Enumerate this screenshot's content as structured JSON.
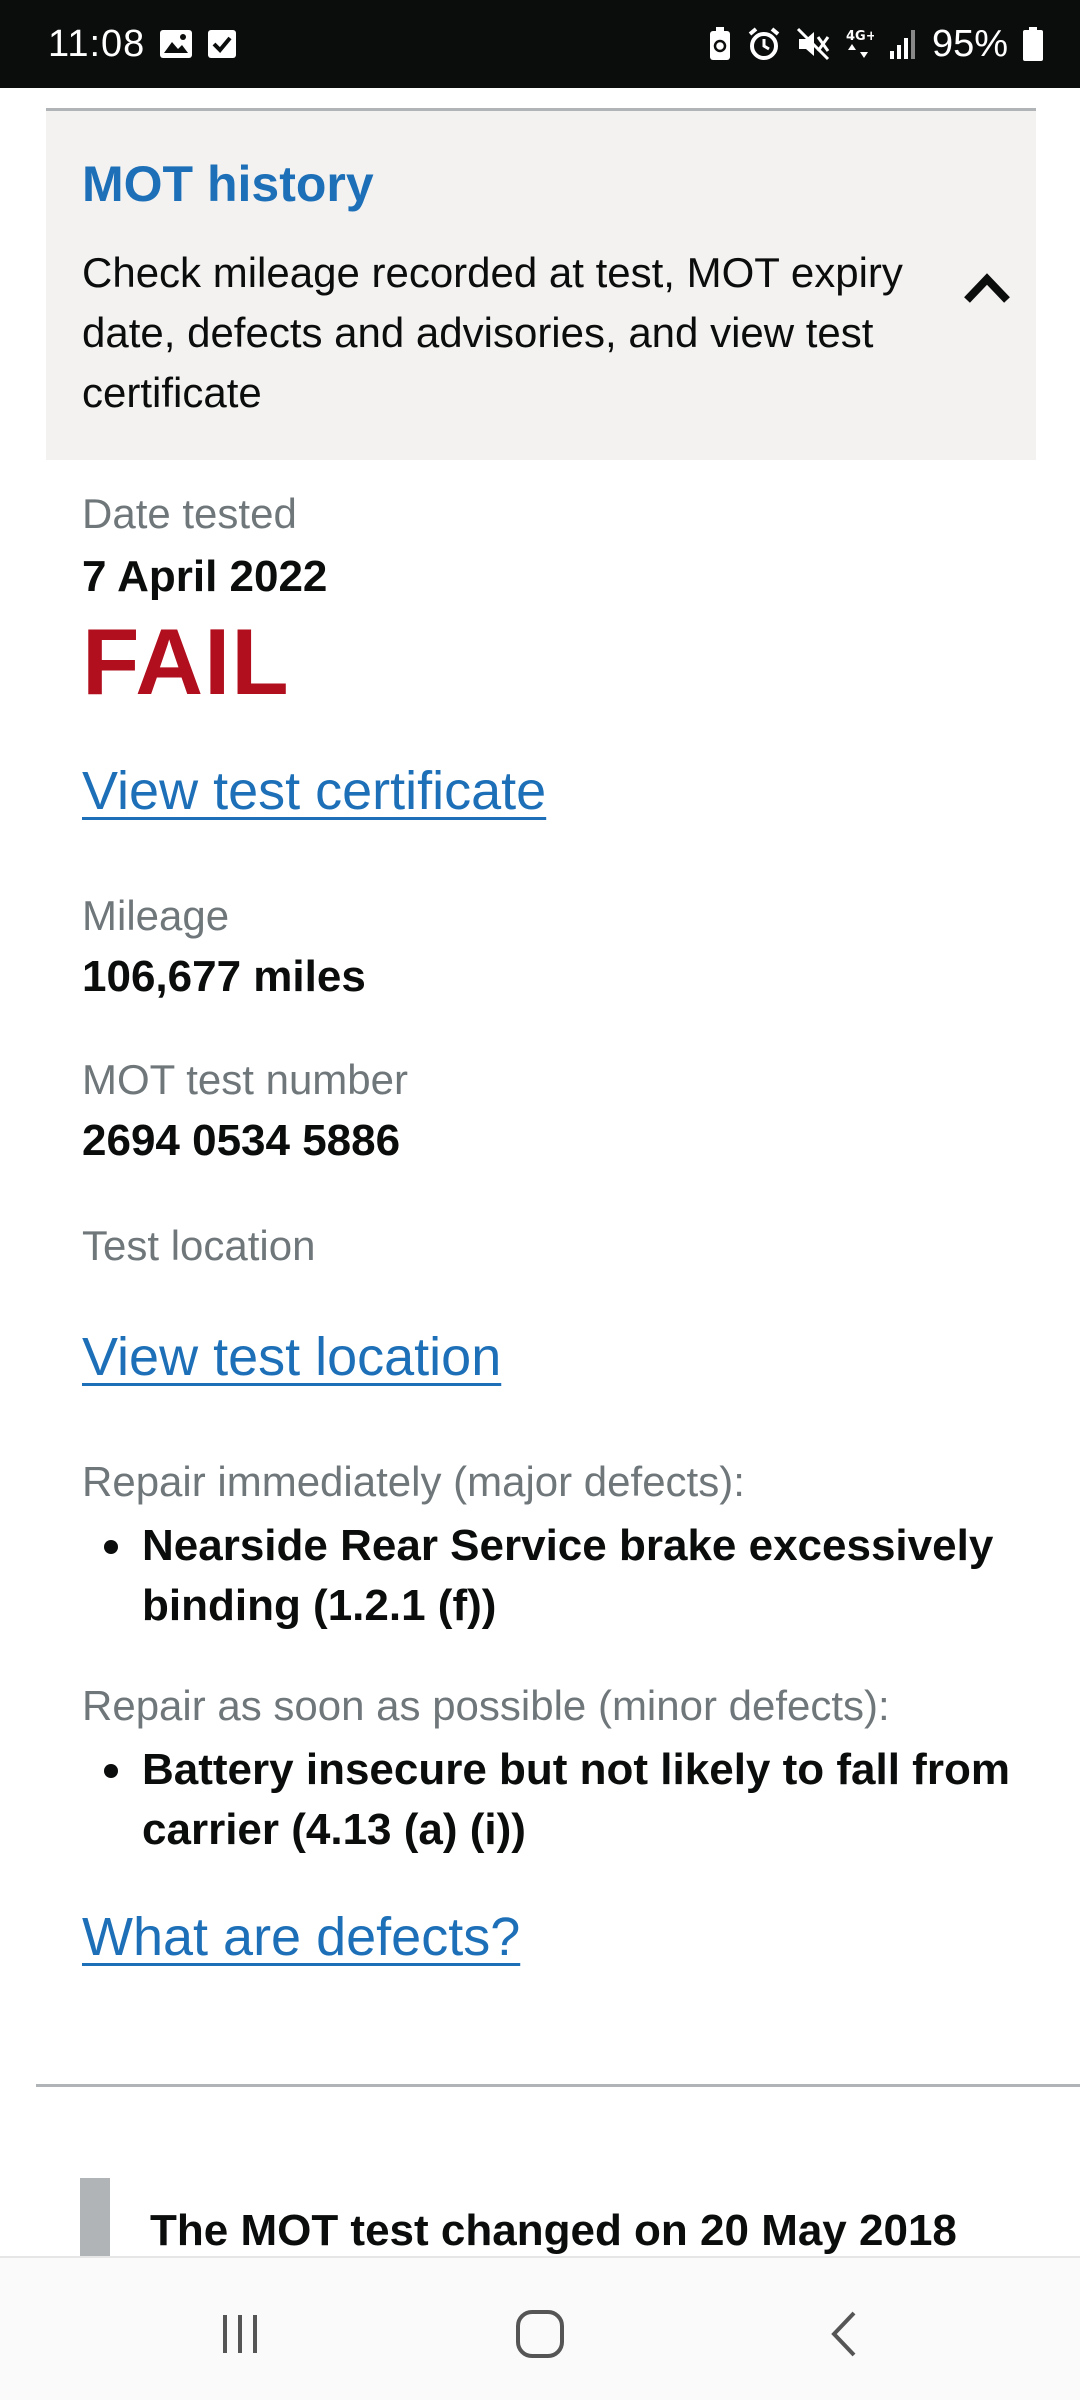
{
  "status_bar": {
    "time": "11:08",
    "battery_percent": "95%",
    "left_icons": [
      "gallery-icon",
      "checkbox-icon"
    ],
    "right_icons": [
      "battery-saver-icon",
      "alarm-icon",
      "mute-icon",
      "4g-icon",
      "signal-icon",
      "battery-icon"
    ]
  },
  "accordion": {
    "title": "MOT history",
    "summary": "Check mileage recorded at test, MOT expiry date, defects and advisories, and view test certificate",
    "expanded": true
  },
  "test": {
    "date_label": "Date tested",
    "date_value": "7 April 2022",
    "result": "FAIL",
    "certificate_link": "View test certificate",
    "mileage_label": "Mileage",
    "mileage_value": "106,677 miles",
    "test_number_label": "MOT test number",
    "test_number_value": "2694 0534 5886",
    "location_label": "Test location",
    "location_link": "View test location",
    "major_label": "Repair immediately (major defects):",
    "major_defects": [
      "Nearside Rear Service brake excessively binding (1.2.1 (f))"
    ],
    "minor_label": "Repair as soon as possible (minor defects):",
    "minor_defects": [
      "Battery insecure but not likely to fall from carrier (4.13 (a) (i))"
    ],
    "defects_link": "What are defects?"
  },
  "inset": {
    "title": "The MOT test changed on 20 May 2018"
  },
  "nav_bar": {
    "buttons": [
      "recents-icon",
      "home-icon",
      "back-icon"
    ]
  },
  "colors": {
    "link": "#1d70b8",
    "fail": "#b10e1e",
    "label": "#6f777b",
    "text": "#0b0c0c",
    "panel": "#f3f2f1"
  }
}
